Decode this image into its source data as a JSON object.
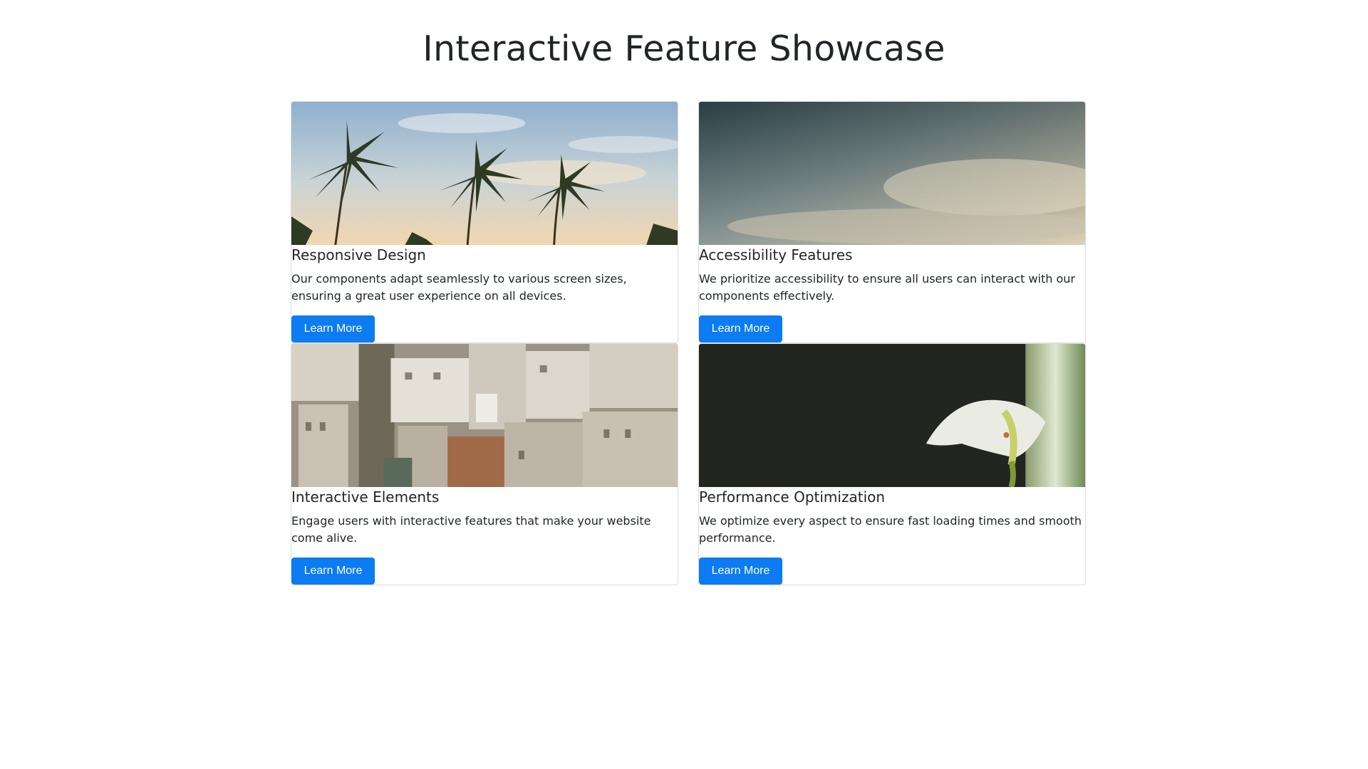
{
  "page": {
    "title": "Interactive Feature Showcase"
  },
  "colors": {
    "button_bg": "#0d7bf2",
    "button_text": "#ffffff",
    "card_border": "#dcdcdc",
    "text": "#212529"
  },
  "cards": [
    {
      "image": "palm-trees-sky-photo",
      "title": "Responsive Design",
      "text": "Our components adapt seamlessly to various screen sizes, ensuring a great user experience on all devices.",
      "button": "Learn More"
    },
    {
      "image": "cloudy-sky-photo",
      "title": "Accessibility Features",
      "text": "We prioritize accessibility to ensure all users can interact with our components effectively.",
      "button": "Learn More"
    },
    {
      "image": "city-rooftops-photo",
      "title": "Interactive Elements",
      "text": "Engage users with interactive features that make your website come alive.",
      "button": "Learn More"
    },
    {
      "image": "calla-lily-photo",
      "title": "Performance Optimization",
      "text": "We optimize every aspect to ensure fast loading times and smooth performance.",
      "button": "Learn More"
    }
  ]
}
